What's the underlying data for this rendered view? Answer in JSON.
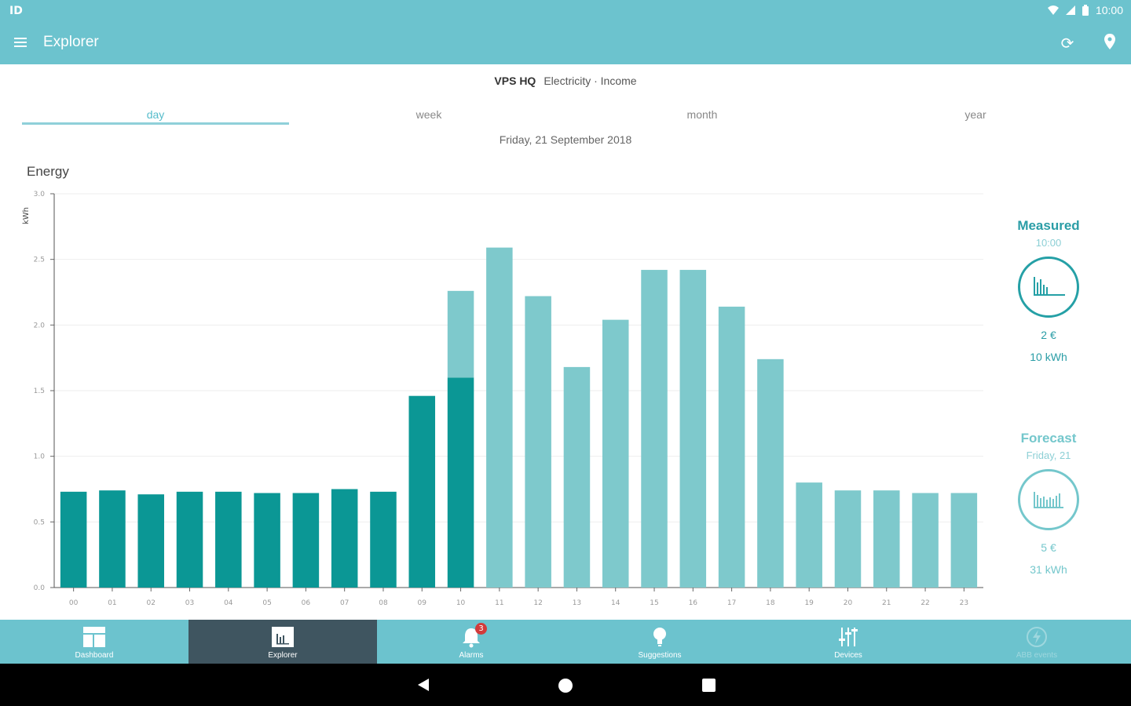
{
  "status_bar": {
    "left_icon": "ID",
    "time": "10:00"
  },
  "app_bar": {
    "title": "Explorer",
    "actions": [
      "refresh-icon",
      "location-pin-icon"
    ]
  },
  "subtitle": {
    "site": "VPS HQ",
    "context": "Electricity · Income"
  },
  "tabs": [
    {
      "label": "day",
      "active": true
    },
    {
      "label": "week",
      "active": false
    },
    {
      "label": "month",
      "active": false
    },
    {
      "label": "year",
      "active": false
    }
  ],
  "date": "Friday, 21 September 2018",
  "chart_title": "Energy",
  "chart_data": {
    "type": "bar",
    "title": "Energy",
    "ylabel": "kWh",
    "xlabel": "",
    "ylim": [
      0,
      3.0
    ],
    "yticks": [
      "0.0",
      "0.5",
      "1.0",
      "1.5",
      "2.0",
      "2.5",
      "3.0"
    ],
    "categories": [
      "00",
      "01",
      "02",
      "03",
      "04",
      "05",
      "06",
      "07",
      "08",
      "09",
      "10",
      "11",
      "12",
      "13",
      "14",
      "15",
      "16",
      "17",
      "18",
      "19",
      "20",
      "21",
      "22",
      "23"
    ],
    "series": [
      {
        "name": "Measured",
        "color": "#0b9795",
        "values": [
          0.73,
          0.74,
          0.71,
          0.73,
          0.73,
          0.72,
          0.72,
          0.75,
          0.73,
          1.46,
          1.6,
          0,
          0,
          0,
          0,
          0,
          0,
          0,
          0,
          0,
          0,
          0,
          0,
          0
        ]
      },
      {
        "name": "Forecast",
        "color": "#7ec9cc",
        "values": [
          0,
          0,
          0,
          0,
          0,
          0,
          0,
          0,
          0,
          0,
          0.66,
          2.59,
          2.22,
          1.68,
          2.04,
          2.42,
          2.42,
          2.14,
          1.74,
          0.8,
          0.74,
          0.74,
          0.72,
          0.72
        ]
      }
    ],
    "grid": true,
    "legend": "none"
  },
  "measured": {
    "title": "Measured",
    "time": "10:00",
    "cost": "2 €",
    "energy": "10 kWh"
  },
  "forecast": {
    "title": "Forecast",
    "day": "Friday, 21",
    "cost": "5 €",
    "energy": "31 kWh"
  },
  "nav": [
    {
      "label": "Dashboard",
      "icon": "dashboard-icon"
    },
    {
      "label": "Explorer",
      "icon": "explorer-icon",
      "active": true
    },
    {
      "label": "Alarms",
      "icon": "bell-icon",
      "badge": "3"
    },
    {
      "label": "Suggestions",
      "icon": "lightbulb-icon"
    },
    {
      "label": "Devices",
      "icon": "sliders-icon"
    },
    {
      "label": "ABB events",
      "icon": "lightning-icon",
      "disabled": true
    }
  ]
}
